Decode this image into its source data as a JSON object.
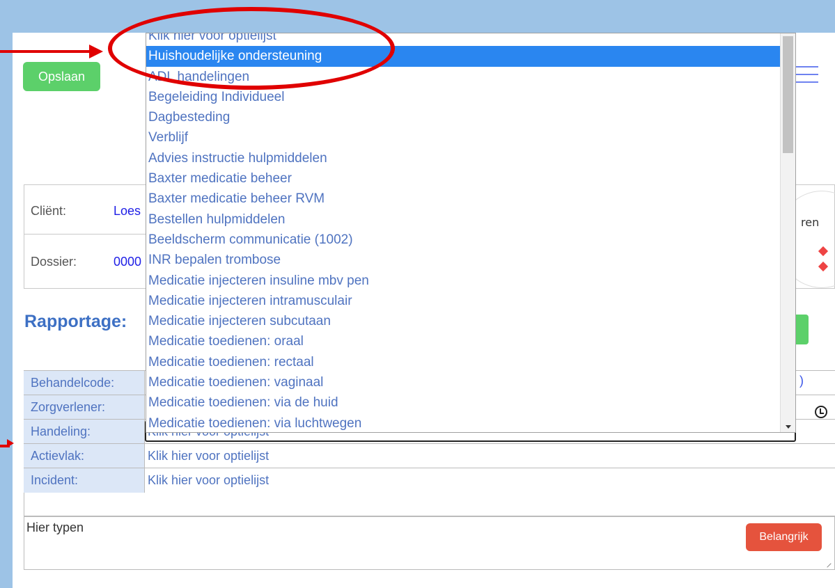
{
  "toolbar": {
    "save_label": "Opslaan"
  },
  "client_info": {
    "client_label": "Cliënt:",
    "client_value": "Loes",
    "dossier_label": "Dossier:",
    "dossier_value": "0000",
    "badge_text": "ren"
  },
  "rapportage": {
    "title": "Rapportage:"
  },
  "fields": [
    {
      "label": "Behandelcode:",
      "value": ""
    },
    {
      "label": "Zorgverlener:",
      "value": ""
    },
    {
      "label": "Handeling:",
      "value": "Klik hier voor optielijst"
    },
    {
      "label": "Actievlak:",
      "value": "Klik hier voor optielijst"
    },
    {
      "label": "Incident:",
      "value": "Klik hier voor optielijst"
    }
  ],
  "notes": {
    "placeholder": "Hier typen",
    "important_label": "Belangrijk"
  },
  "behandelcode_tail": ")",
  "dropdown": {
    "selected_index": 1,
    "items": [
      "Klik hier voor optielijst",
      "Huishoudelijke ondersteuning",
      "ADL handelingen",
      "Begeleiding Individueel",
      "Dagbesteding",
      "Verblijf",
      "Advies instructie hulpmiddelen",
      "Baxter medicatie beheer",
      "Baxter medicatie beheer RVM",
      "Bestellen hulpmiddelen",
      "Beeldscherm communicatie (1002)",
      "INR bepalen trombose",
      "Medicatie injecteren insuline mbv pen",
      "Medicatie injecteren intramusculair",
      "Medicatie injecteren subcutaan",
      "Medicatie toedienen: oraal",
      "Medicatie toedienen: rectaal",
      "Medicatie toedienen: vaginaal",
      "Medicatie toedienen: via de huid",
      "Medicatie toedienen: via luchtwegen"
    ]
  },
  "colors": {
    "accent_green": "#5cd06a",
    "selected_blue": "#2a86f0",
    "annotation_red": "#e00000",
    "important_red": "#e5533d"
  }
}
